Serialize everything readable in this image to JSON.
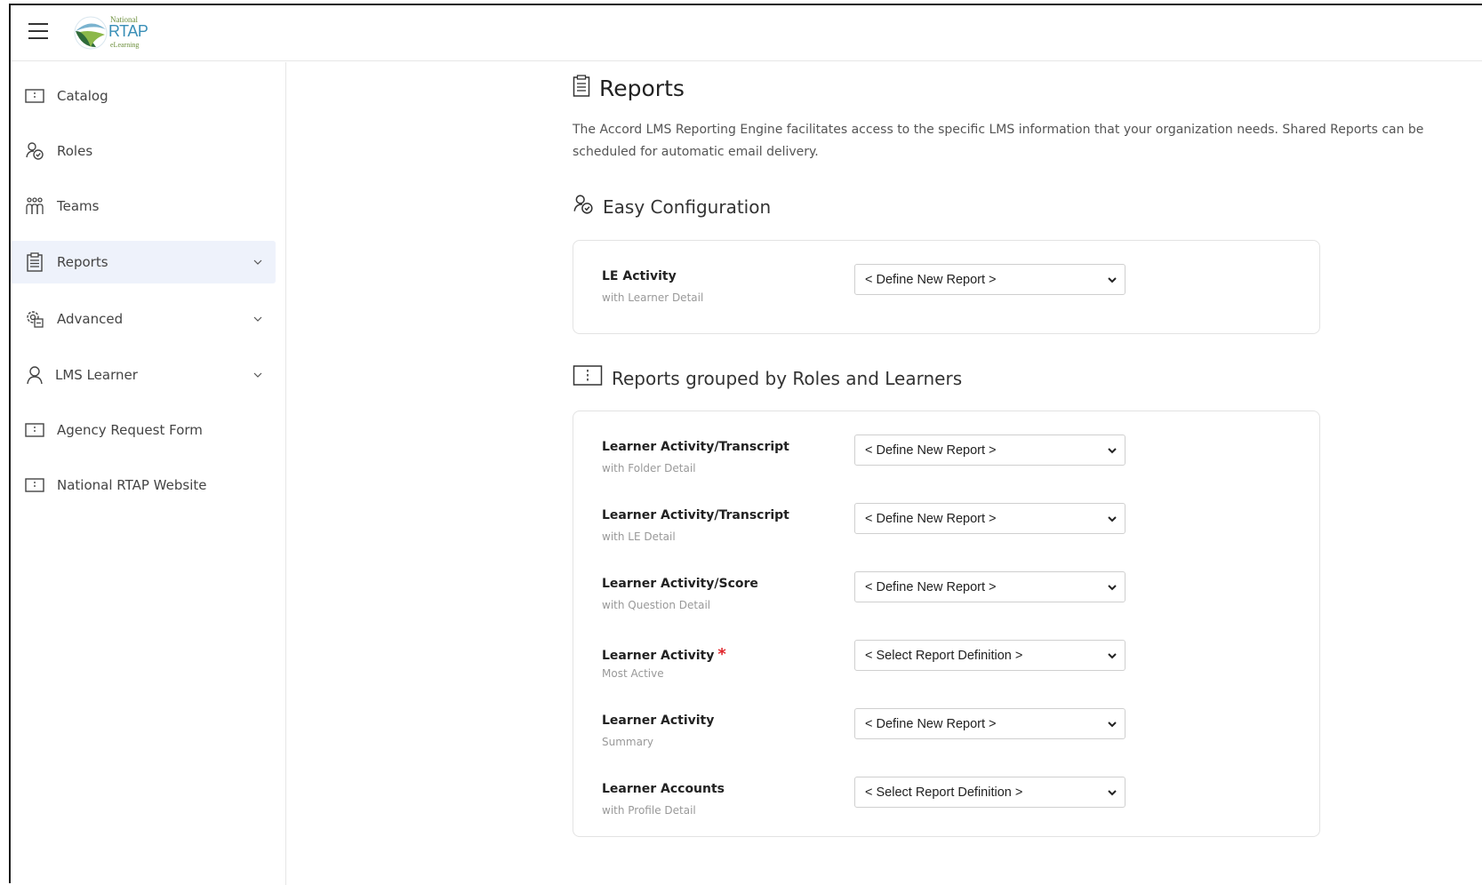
{
  "header": {
    "logo": {
      "national": "National",
      "rtap": "RTAP",
      "elearning": "eLearning"
    }
  },
  "sidebar": {
    "items": [
      {
        "label": "Catalog",
        "icon": "book-icon"
      },
      {
        "label": "Roles",
        "icon": "user-check-icon"
      },
      {
        "label": "Teams",
        "icon": "team-icon"
      },
      {
        "label": "Reports",
        "icon": "clipboard-icon",
        "active": true
      },
      {
        "label": "Advanced",
        "icon": "gears-icon"
      },
      {
        "label": "LMS Learner",
        "icon": "user-icon"
      },
      {
        "label": "Agency Request Form",
        "icon": "book-icon"
      },
      {
        "label": "National RTAP Website",
        "icon": "book-icon"
      }
    ]
  },
  "main": {
    "title": "Reports",
    "description_line1": "The Accord LMS Reporting Engine facilitates access to the specific LMS information that your organization needs. Shared Reports can be",
    "description_line2": "scheduled for automatic email delivery.",
    "easy_config": {
      "title": "Easy Configuration",
      "rows": [
        {
          "name": "LE Activity",
          "sub": "with Learner Detail",
          "value": "< Define New Report >"
        }
      ]
    },
    "grouped": {
      "title": "Reports grouped by Roles and Learners",
      "rows": [
        {
          "name": "Learner Activity/Transcript",
          "sub": "with Folder Detail",
          "value": "< Define New Report >"
        },
        {
          "name": "Learner Activity/Transcript",
          "sub": "with LE Detail",
          "value": "< Define New Report >"
        },
        {
          "name": "Learner Activity/Score",
          "sub": "with Question Detail",
          "value": "< Define New Report >"
        },
        {
          "name": "Learner Activity",
          "sub": "Most Active",
          "value": "< Select Report Definition >",
          "required_mark": "*"
        },
        {
          "name": "Learner Activity",
          "sub": "Summary",
          "value": "< Define New Report >"
        },
        {
          "name": "Learner Accounts",
          "sub": "with Profile Detail",
          "value": "< Select Report Definition >"
        }
      ]
    }
  }
}
